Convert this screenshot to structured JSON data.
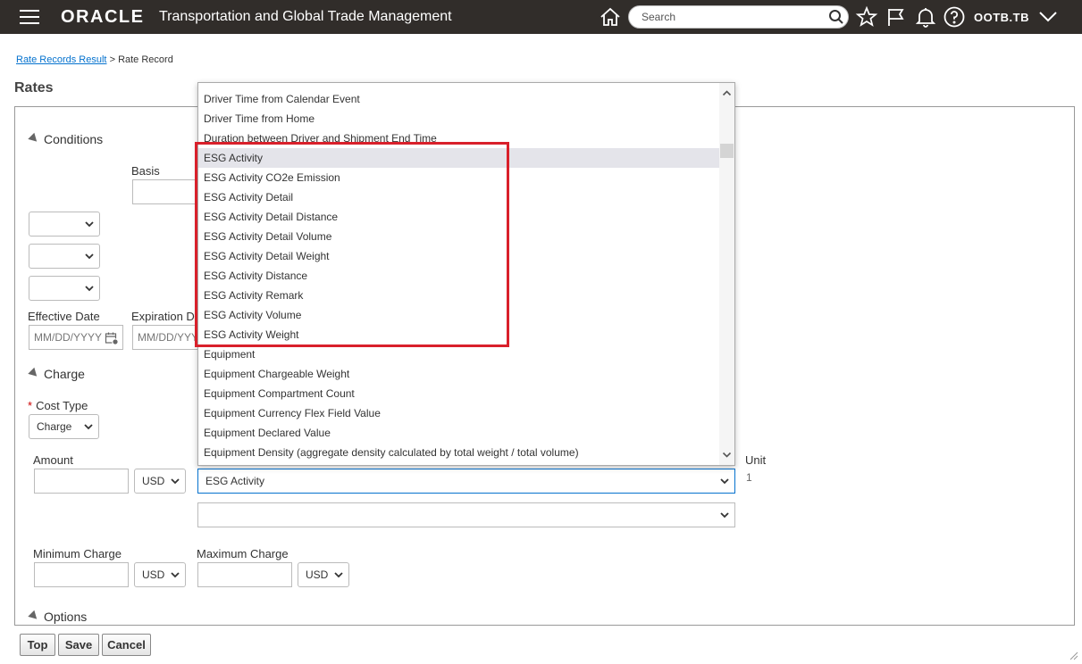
{
  "header": {
    "brand": "ORACLE",
    "app_title": "Transportation and Global Trade Management",
    "search_placeholder": "Search",
    "user": "OOTB.TB"
  },
  "breadcrumb": {
    "parent": "Rate Records Result",
    "separator": ">",
    "current": "Rate Record"
  },
  "page": {
    "title": "Rates"
  },
  "conditions": {
    "section_label": "Conditions",
    "basis_label": "Basis",
    "effective_date_label": "Effective Date",
    "expiration_date_label": "Expiration D",
    "effective_date_placeholder": "MM/DD/YYYY",
    "expiration_date_placeholder": "MM/DD/YYYY"
  },
  "charge": {
    "section_label": "Charge",
    "cost_type_label": "Cost Type",
    "cost_type_value": "Charge",
    "amount_label": "Amount",
    "currency_value": "USD",
    "selected_attribute": "ESG Activity",
    "unit_label": "Unit",
    "unit_value": "1",
    "minimum_charge_label": "Minimum Charge",
    "minimum_currency": "USD",
    "maximum_charge_label": "Maximum Charge",
    "maximum_currency": "USD"
  },
  "options": {
    "section_label": "Options"
  },
  "buttons": {
    "top": "Top",
    "save": "Save",
    "cancel": "Cancel"
  },
  "dropdown": {
    "items": [
      "Driver Time from Calendar Event",
      "Driver Time from Home",
      "Duration between Driver and Shipment End Time",
      "ESG Activity",
      "ESG Activity CO2e Emission",
      "ESG Activity Detail",
      "ESG Activity Detail Distance",
      "ESG Activity Detail Volume",
      "ESG Activity Detail Weight",
      "ESG Activity Distance",
      "ESG Activity Remark",
      "ESG Activity Volume",
      "ESG Activity Weight",
      "Equipment",
      "Equipment Chargeable Weight",
      "Equipment Compartment Count",
      "Equipment Currency Flex Field Value",
      "Equipment Declared Value",
      "Equipment Density (aggregate density calculated by total weight / total volume)"
    ],
    "highlighted_index": 3
  },
  "colors": {
    "header_bg": "#312d2a",
    "link": "#0572ce",
    "highlight_box": "#d9202b",
    "focus_border": "#0572ce"
  }
}
